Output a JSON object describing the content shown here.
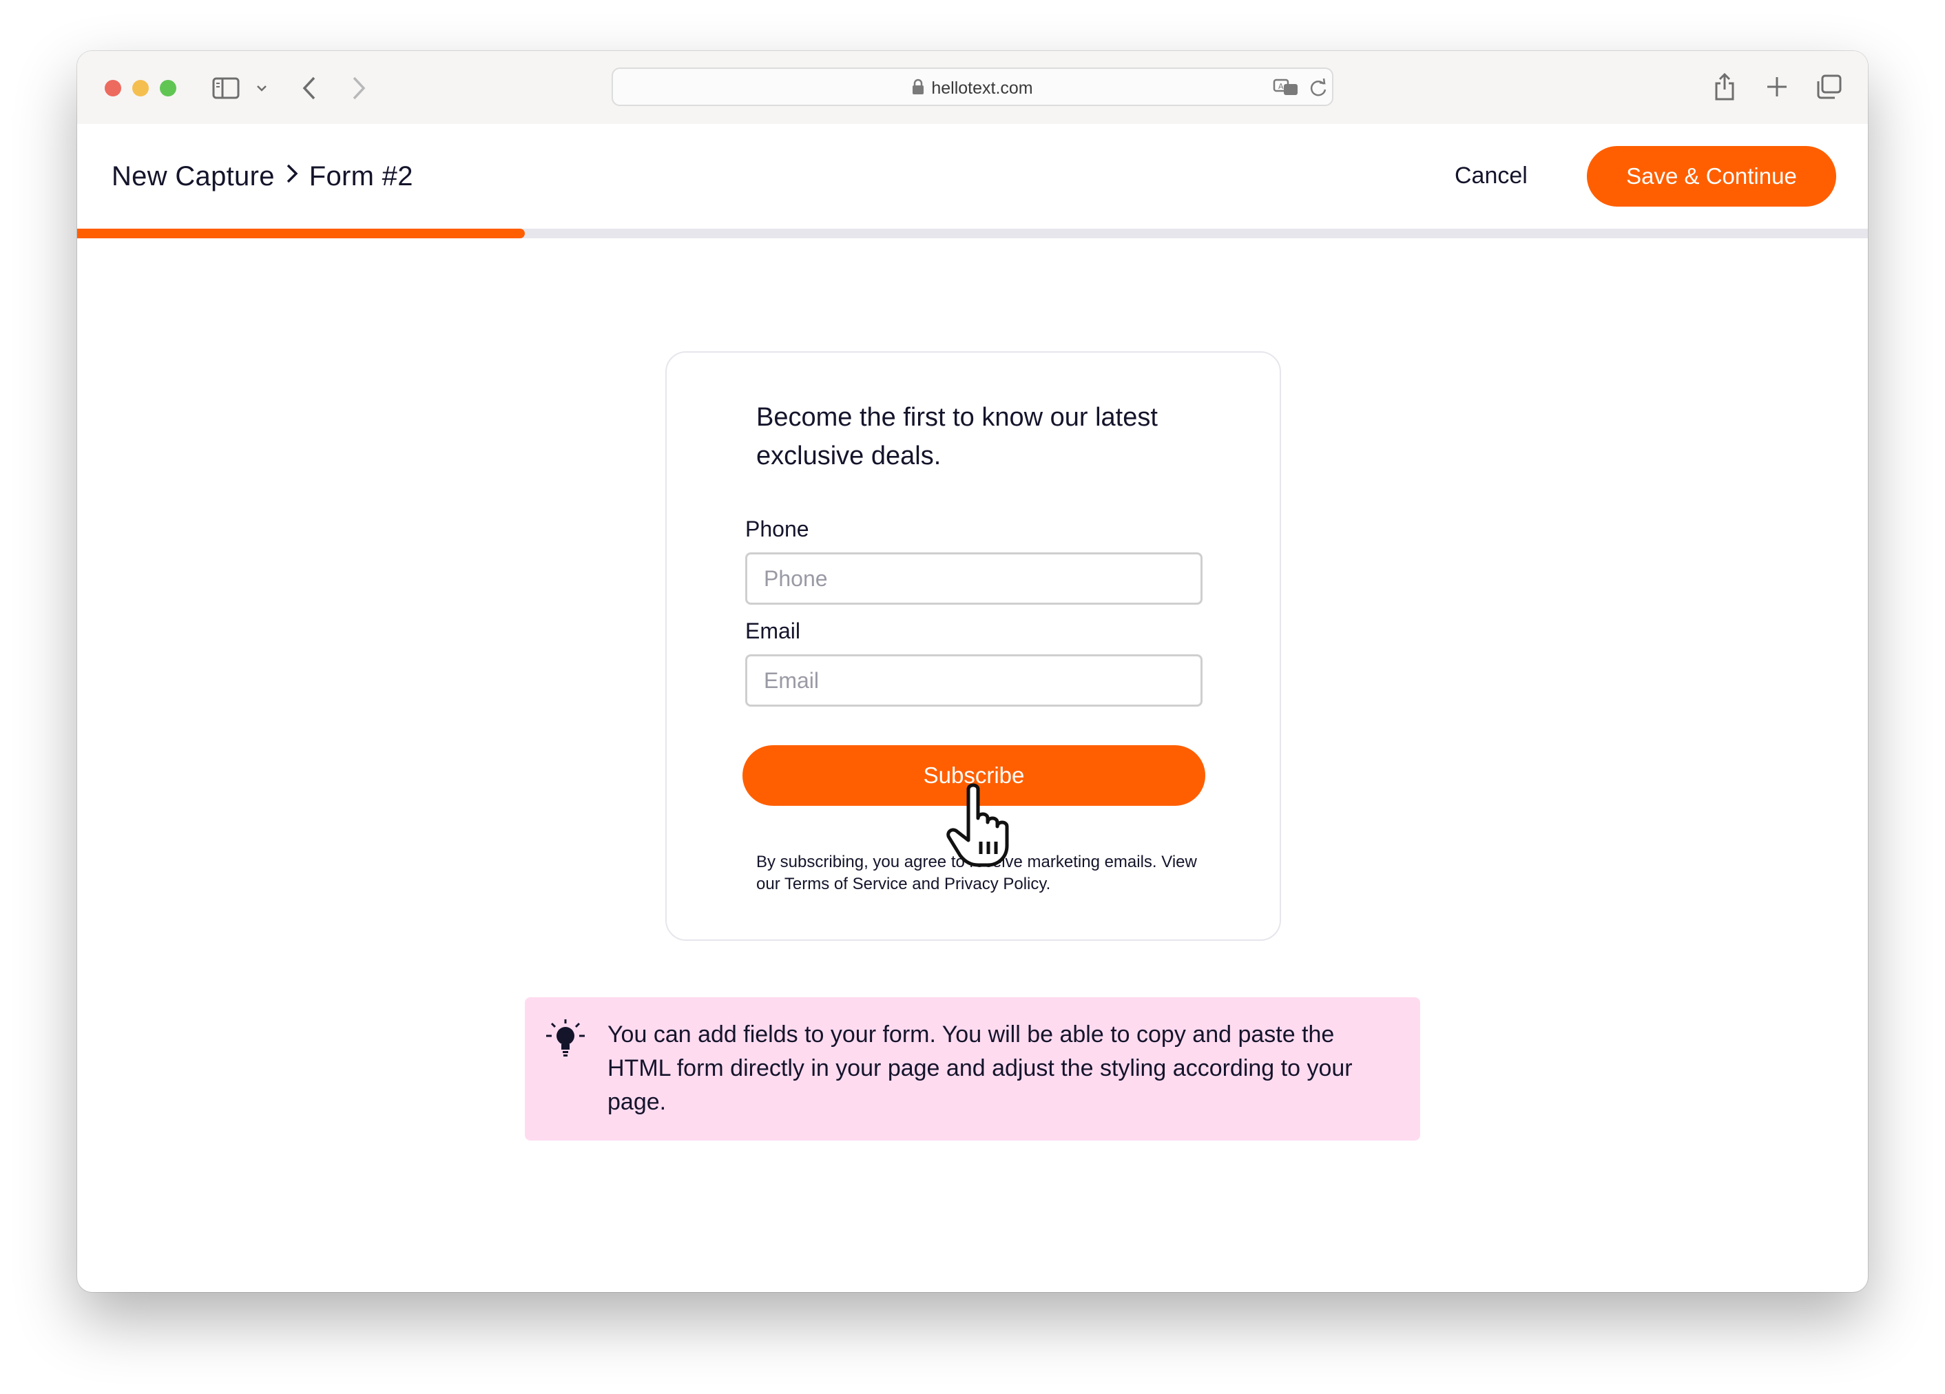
{
  "browser": {
    "url": "hellotext.com"
  },
  "header": {
    "breadcrumb": [
      "New Capture",
      "Form #2"
    ],
    "cancel_label": "Cancel",
    "save_label": "Save & Continue"
  },
  "progress": {
    "fraction": 0.25
  },
  "form": {
    "headline": "Become the first to know our latest exclusive deals.",
    "phone_label": "Phone",
    "phone_placeholder": "Phone",
    "phone_value": "",
    "email_label": "Email",
    "email_placeholder": "Email",
    "email_value": "",
    "subscribe_label": "Subscribe",
    "legal_text": "By subscribing, you agree to receive marketing emails. View our Terms of Service and Privacy Policy."
  },
  "tip": {
    "icon": "lightbulb-icon",
    "text": "You can add fields to your form. You will be able to copy and paste the HTML form directly in your page and adjust the styling according to your page."
  },
  "colors": {
    "accent": "#ff5f00",
    "tip_background": "#ffdbf0",
    "text": "#14142b",
    "progress_track": "#e6e6ec"
  }
}
